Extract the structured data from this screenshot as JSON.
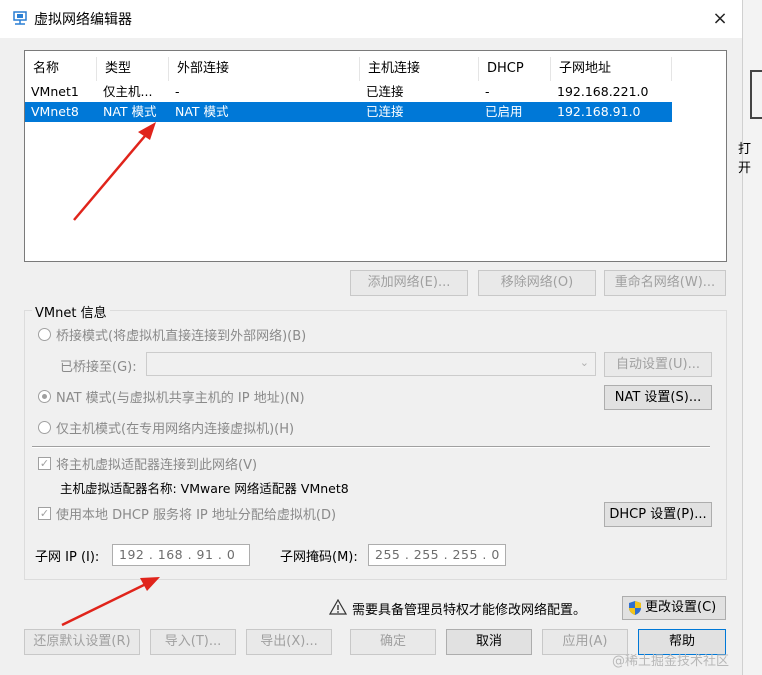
{
  "window": {
    "title": "虚拟网络编辑器",
    "close": "×"
  },
  "right_strip": {
    "text": "打开"
  },
  "table": {
    "headers": [
      "名称",
      "类型",
      "外部连接",
      "主机连接",
      "DHCP",
      "子网地址"
    ],
    "rows": [
      [
        "VMnet1",
        "仅主机...",
        "-",
        "已连接",
        "-",
        "192.168.221.0"
      ],
      [
        "VMnet8",
        "NAT 模式",
        "NAT 模式",
        "已连接",
        "已启用",
        "192.168.91.0"
      ]
    ],
    "selected_row": 1
  },
  "net_buttons": {
    "add": "添加网络(E)...",
    "remove": "移除网络(O)",
    "rename": "重命名网络(W)..."
  },
  "vmnet_info": {
    "group_title": "VMnet 信息",
    "bridge_mode": "桥接模式(将虚拟机直接连接到外部网络)(B)",
    "bridged_to_label": "已桥接至(G):",
    "auto_settings": "自动设置(U)...",
    "nat_mode": "NAT 模式(与虚拟机共享主机的 IP 地址)(N)",
    "nat_settings": "NAT 设置(S)...",
    "host_only_mode": "仅主机模式(在专用网络内连接虚拟机)(H)",
    "connect_adapter": "将主机虚拟适配器连接到此网络(V)",
    "adapter_name": "主机虚拟适配器名称: VMware 网络适配器 VMnet8",
    "use_dhcp": "使用本地 DHCP 服务将 IP 地址分配给虚拟机(D)",
    "dhcp_settings": "DHCP 设置(P)...",
    "subnet_ip_label": "子网 IP (I):",
    "subnet_ip": "192 . 168 . 91  .  0",
    "subnet_mask_label": "子网掩码(M):",
    "subnet_mask": "255 . 255 . 255 .  0",
    "selected_mode": "nat",
    "connect_adapter_checked": true,
    "use_dhcp_checked": true
  },
  "admin": {
    "warning": "需要具备管理员特权才能修改网络配置。",
    "change_settings": "更改设置(C)"
  },
  "footer": {
    "restore": "还原默认设置(R)",
    "import": "导入(T)...",
    "export": "导出(X)...",
    "ok": "确定",
    "cancel": "取消",
    "apply": "应用(A)",
    "help": "帮助"
  },
  "watermark": "@稀土掘金技术社区",
  "colors": {
    "selection": "#0078d7",
    "annotation_arrow": "#e0241b",
    "disabled_text": "#a0a0a0"
  }
}
